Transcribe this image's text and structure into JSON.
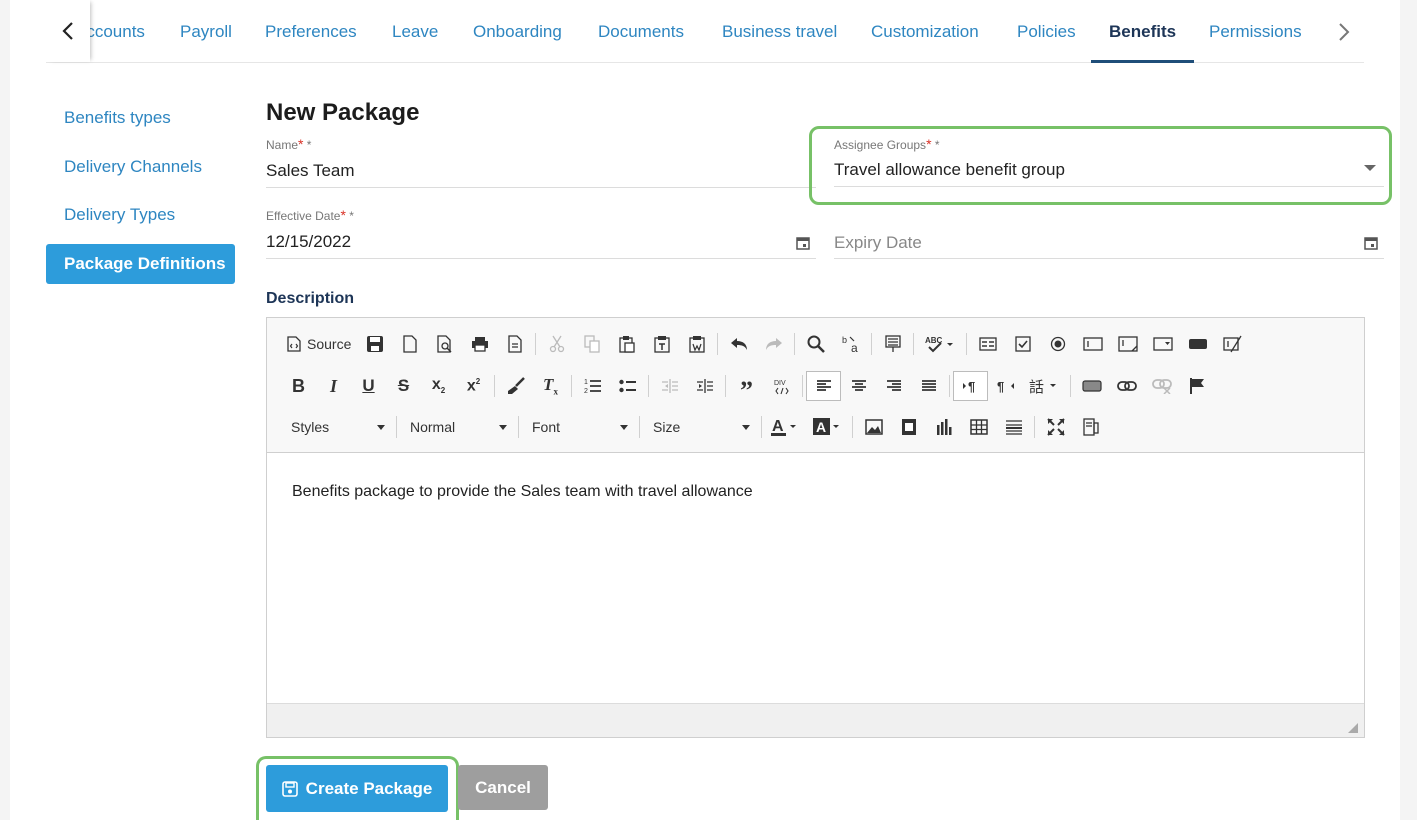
{
  "tabs": [
    {
      "label": "Accounts",
      "active": false
    },
    {
      "label": "Payroll",
      "active": false
    },
    {
      "label": "Preferences",
      "active": false
    },
    {
      "label": "Leave",
      "active": false
    },
    {
      "label": "Onboarding",
      "active": false
    },
    {
      "label": "Documents",
      "active": false
    },
    {
      "label": "Business travel",
      "active": false
    },
    {
      "label": "Customization",
      "active": false
    },
    {
      "label": "Policies",
      "active": false
    },
    {
      "label": "Benefits",
      "active": true
    },
    {
      "label": "Permissions",
      "active": false
    }
  ],
  "sidebar": {
    "items": [
      {
        "label": "Benefits types",
        "active": false
      },
      {
        "label": "Delivery Channels",
        "active": false
      },
      {
        "label": "Delivery Types",
        "active": false
      },
      {
        "label": "Package Definitions",
        "active": true
      }
    ]
  },
  "form": {
    "title": "New Package",
    "name": {
      "label": "Name",
      "required_mark": "*",
      "asterisk": " *",
      "value": "Sales Team"
    },
    "assignee_groups": {
      "label": "Assignee Groups",
      "required_mark": "*",
      "asterisk": " *",
      "value": "Travel allowance benefit group"
    },
    "effective_date": {
      "label": "Effective Date",
      "required_mark": "*",
      "asterisk": " *",
      "value": "12/15/2022"
    },
    "expiry_date": {
      "placeholder": "Expiry Date",
      "value": ""
    },
    "description_label": "Description"
  },
  "editor": {
    "source_label": "Source",
    "styles_label": "Styles",
    "format_label": "Normal",
    "font_label": "Font",
    "size_label": "Size",
    "content": "Benefits package to provide the Sales team with travel allowance"
  },
  "buttons": {
    "create_label": "Create Package",
    "cancel_label": "Cancel"
  },
  "colors": {
    "accent": "#2d9cdb",
    "tab_text": "#2e86c1",
    "active_tab": "#1d3557",
    "highlight": "#77c167",
    "required": "#d93025"
  }
}
